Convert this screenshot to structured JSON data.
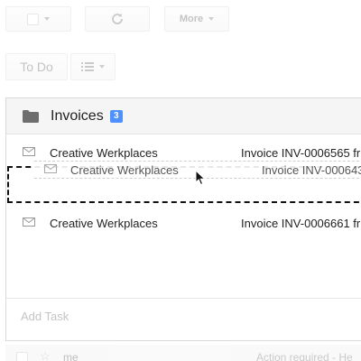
{
  "toolbar": {
    "more_label": "More",
    "list_label": "To Do"
  },
  "panel": {
    "title": "Invoices",
    "count": "3",
    "rows": [
      {
        "sender": "Creative Werkplaces",
        "subject": "Invoice INV-0006565 fr"
      },
      {
        "sender": "Creative Werkplaces",
        "subject": "Invoice INV-0006661 fr"
      }
    ],
    "dragged": {
      "sender": "Creative Werkplaces",
      "subject": "Invoice INV-000643"
    },
    "add_task_placeholder": "Add Task"
  },
  "footer_row": {
    "sender": "me",
    "subject": "Action required - He"
  },
  "colors": {
    "badge": "#4d90fe",
    "drop_outline": "#111111"
  },
  "icons": {
    "refresh": "refresh-icon",
    "list": "list-icon",
    "folder": "folder-icon",
    "envelope": "envelope-icon",
    "cursor": "mouse-cursor-icon"
  }
}
